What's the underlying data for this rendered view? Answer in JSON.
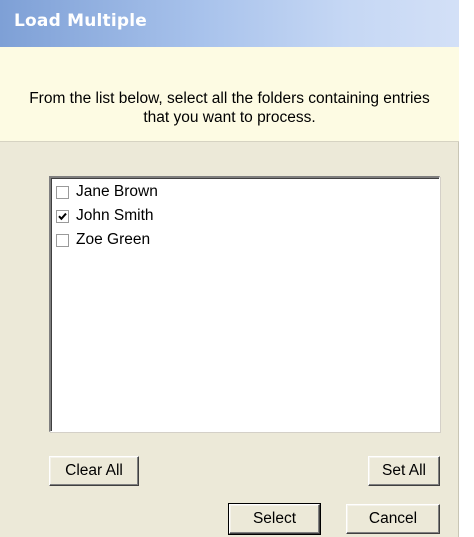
{
  "window": {
    "title": "Load Multiple"
  },
  "instructions": {
    "text": "From the list below, select all the folders containing entries that you want to process."
  },
  "folders": [
    {
      "label": "Jane Brown",
      "checked": false
    },
    {
      "label": "John Smith",
      "checked": true
    },
    {
      "label": "Zoe Green",
      "checked": false
    }
  ],
  "buttons": {
    "clear_all": "Clear All",
    "set_all": "Set All",
    "select": "Select",
    "cancel": "Cancel"
  },
  "colors": {
    "title_gradient_start": "#7ea0d6",
    "title_gradient_end": "#d3e0f7",
    "instruction_background": "#fdfbe3",
    "dialog_background": "#ece9d8"
  }
}
